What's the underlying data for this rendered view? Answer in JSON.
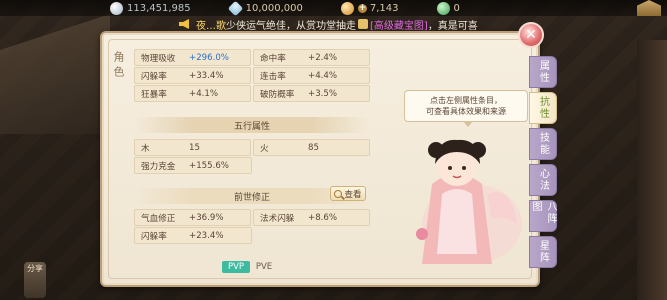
{
  "topbar": {
    "silver": "113,451,985",
    "gem": "10,000,000",
    "coin": "7,143",
    "jade": "0"
  },
  "announcement": {
    "name": "夜…歌",
    "text": "少侠运气绝佳，从赏功堂抽走",
    "item": "[高级藏宝图]",
    "suffix": "，真是可喜"
  },
  "panel": {
    "side_label": "角色",
    "attrs_top": [
      [
        {
          "label": "物理吸收",
          "value": "+296.0%",
          "blue": true
        },
        {
          "label": "命中率",
          "value": "+2.4%",
          "blue": false
        }
      ],
      [
        {
          "label": "闪躲率",
          "value": "+33.4%",
          "blue": false
        },
        {
          "label": "连击率",
          "value": "+4.4%",
          "blue": false
        }
      ],
      [
        {
          "label": "狂暴率",
          "value": "+4.1%",
          "blue": false
        },
        {
          "label": "破防概率",
          "value": "+3.5%",
          "blue": false
        }
      ]
    ],
    "wuxing_title": "五行属性",
    "wuxing": [
      [
        {
          "label": "木",
          "value": "15"
        },
        {
          "label": "火",
          "value": "85"
        }
      ],
      [
        {
          "label": "强力克金",
          "value": "+155.6%"
        }
      ]
    ],
    "qianshi_title": "前世修正",
    "view_label": "查看",
    "qianshi": [
      [
        {
          "label": "气血修正",
          "value": "+36.9%"
        },
        {
          "label": "法术闪躲",
          "value": "+8.6%"
        }
      ],
      [
        {
          "label": "闪躲率",
          "value": "+23.4%"
        }
      ]
    ],
    "toggle": {
      "pvp": "PVP",
      "pve": "PVE",
      "active": "PVP"
    },
    "tooltip": [
      "点击左侧属性条目，",
      "可查看具体效果和来源"
    ]
  },
  "tabs": [
    {
      "label": "属性",
      "active": false
    },
    {
      "label": "抗性",
      "active": true
    },
    {
      "label": "技能",
      "active": false
    },
    {
      "label": "心法",
      "active": false
    },
    {
      "label": "八阵图",
      "active": false
    },
    {
      "label": "星阵",
      "active": false
    }
  ],
  "share_label": "分享",
  "colors": {
    "accent_blue": "#2f72c8",
    "toggle_active": "#3dbba0",
    "tab_inactive": "#a794bd",
    "close_red": "#e06b6b"
  }
}
